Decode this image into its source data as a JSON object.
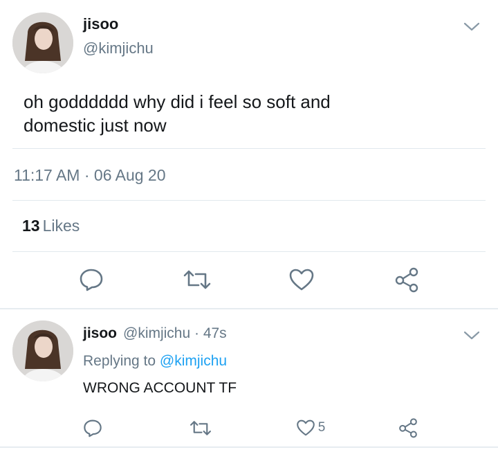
{
  "main_tweet": {
    "display_name": "jisoo",
    "handle": "@kimjichu",
    "text_line1": "oh godddddd why did i feel so soft and",
    "text_line2": "domestic just now",
    "timestamp": "11:17 AM · 06 Aug 20",
    "likes_count": "13",
    "likes_label": "Likes",
    "icons": [
      "reply-icon",
      "retweet-icon",
      "like-icon",
      "share-icon",
      "chevron-down-icon"
    ]
  },
  "reply_tweet": {
    "display_name": "jisoo",
    "meta": "@kimjichu · 47s",
    "replying_prefix": "Replying to",
    "replying_mention": "@kimjichu",
    "text": "WRONG ACCOUNT TF",
    "like_count": "5",
    "icons": [
      "reply-icon",
      "retweet-icon",
      "like-icon",
      "share-icon",
      "chevron-down-icon"
    ]
  },
  "colors": {
    "text": "#14171a",
    "secondary": "#657786",
    "link": "#1da1f2",
    "icon": "#657786",
    "divider": "#e1e8ed"
  }
}
